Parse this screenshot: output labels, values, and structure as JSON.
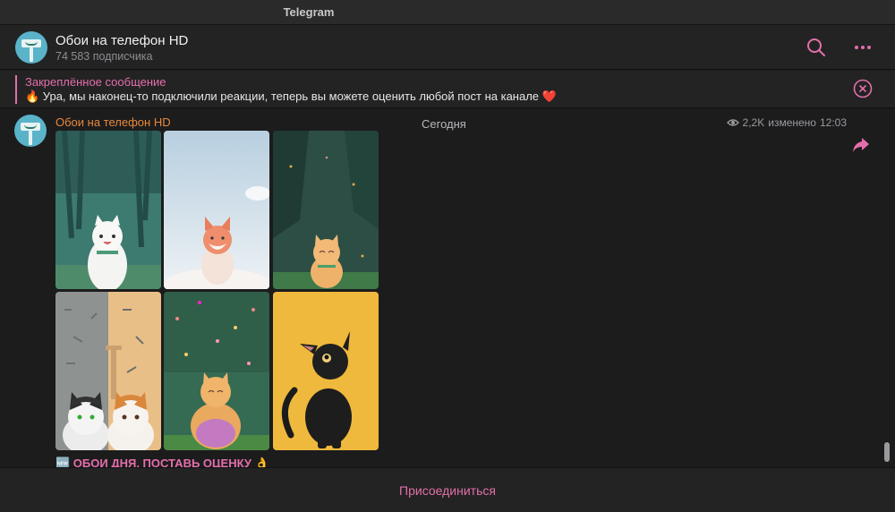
{
  "window": {
    "title": "Telegram"
  },
  "channel": {
    "name": "Обои на телефон HD",
    "subscribers": "74 583 подписчика"
  },
  "pinned": {
    "title": "Закреплённое сообщение",
    "text": "🔥 Ура, мы наконец-то подключили реакции, теперь вы можете оценить любой пост на канале ❤️"
  },
  "feed": {
    "date": "Сегодня",
    "post": {
      "author": "Обои на телефон HD",
      "views": "2,2K",
      "edited": "изменено",
      "time": "12:03",
      "caption": "🆕 ОБОИ ДНЯ, ПОСТАВЬ ОЦЕНКУ 👌",
      "images": [
        "white-cat-forest",
        "fox-sky",
        "cat-forest-night",
        "two-kittens-pattern",
        "cat-confetti",
        "black-cat-yellow"
      ]
    }
  },
  "footer": {
    "join_label": "Присоединиться"
  },
  "colors": {
    "accent": "#e36faa",
    "author": "#e9883b",
    "background": "#1c1c1d"
  }
}
